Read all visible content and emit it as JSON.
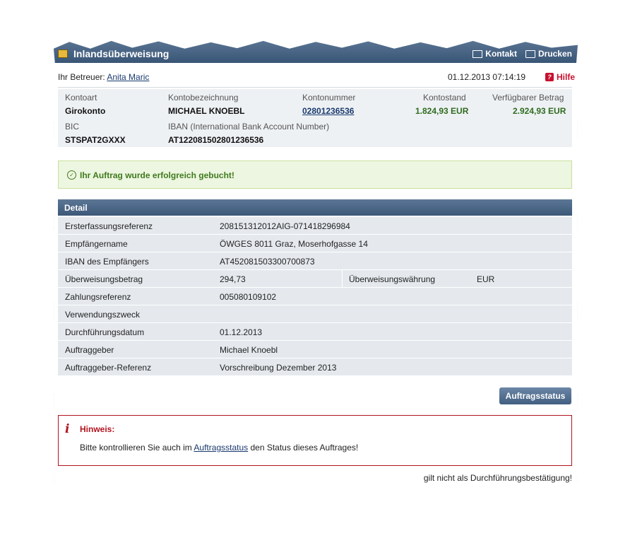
{
  "header": {
    "title": "Inlandsüberweisung",
    "contact_label": "Kontakt",
    "print_label": "Drucken"
  },
  "betreuer": {
    "label": "Ihr Betreuer:",
    "name": "Anita Maric",
    "datetime": "01.12.2013 07:14:19",
    "help_label": "Hilfe"
  },
  "account": {
    "labels": {
      "type": "Kontoart",
      "name": "Kontobezeichnung",
      "number": "Kontonummer",
      "balance": "Kontostand",
      "available": "Verfügbarer Betrag",
      "bic": "BIC",
      "iban": "IBAN (International Bank Account Number)"
    },
    "type": "Girokonto",
    "name": "MICHAEL KNOEBL",
    "number": "02801236536",
    "balance": "1.824,93 EUR",
    "available": "2.924,93 EUR",
    "bic": "STSPAT2GXXX",
    "iban": "AT122081502801236536"
  },
  "success_message": "Ihr Auftrag wurde erfolgreich gebucht!",
  "detail": {
    "heading": "Detail",
    "rows": [
      {
        "key": "Ersterfassungsreferenz",
        "value": "208151312012AIG-071418296984"
      },
      {
        "key": "Empfängername",
        "value": "ÖWGES 8011 Graz, Moserhofgasse 14"
      },
      {
        "key": "IBAN des Empfängers",
        "value": "AT452081503300700873"
      },
      {
        "key": "Überweisungsbetrag",
        "value": "294,73",
        "key2": "Überweisungswährung",
        "value2": "EUR"
      },
      {
        "key": "Zahlungsreferenz",
        "value": "005080109102"
      },
      {
        "key": "Verwendungszweck",
        "value": ""
      },
      {
        "key": "Durchführungsdatum",
        "value": "01.12.2013"
      },
      {
        "key": "Auftraggeber",
        "value": "Michael Knoebl"
      },
      {
        "key": "Auftraggeber-Referenz",
        "value": "Vorschreibung Dezember 2013"
      }
    ]
  },
  "status_button": "Auftragsstatus",
  "hinweis": {
    "title": "Hinweis:",
    "text_before": "Bitte kontrollieren Sie auch im ",
    "link": "Auftragsstatus",
    "text_after": " den Status dieses Auftrages!"
  },
  "footer_note": "gilt nicht als Durchführungsbestätigung!"
}
